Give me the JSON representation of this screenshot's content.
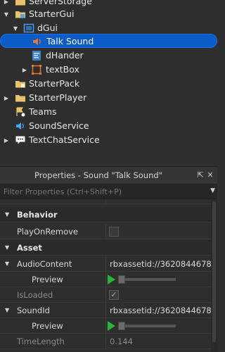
{
  "explorer": {
    "items": [
      {
        "label": "ServerStorage",
        "icon": "folder-icon"
      },
      {
        "label": "StarterGui",
        "icon": "startergui-icon"
      },
      {
        "label": "dGui",
        "icon": "screengui-icon"
      },
      {
        "label": "Talk Sound",
        "icon": "sound-icon"
      },
      {
        "label": "dHander",
        "icon": "script-icon"
      },
      {
        "label": "textBox",
        "icon": "frame-icon"
      },
      {
        "label": "StarterPack",
        "icon": "folder-icon"
      },
      {
        "label": "StarterPlayer",
        "icon": "folder-icon"
      },
      {
        "label": "Teams",
        "icon": "teams-icon"
      },
      {
        "label": "SoundService",
        "icon": "soundservice-icon"
      },
      {
        "label": "TextChatService",
        "icon": "chat-icon"
      }
    ]
  },
  "properties": {
    "title": "Properties - Sound \"Talk Sound\"",
    "filter_placeholder": "Filter Properties (Ctrl+Shift+P)",
    "sections": {
      "behavior": "Behavior",
      "asset": "Asset"
    },
    "rows": {
      "play_on_remove": "PlayOnRemove",
      "audio_content": "AudioContent",
      "audio_content_value": "rbxassetid://3620844678",
      "preview": "Preview",
      "is_loaded": "IsLoaded",
      "sound_id": "SoundId",
      "sound_id_value": "rbxassetid://3620844678",
      "preview2": "Preview",
      "time_length": "TimeLength",
      "time_length_value": "0.144"
    }
  },
  "colors": {
    "selection": "#0b5cc6",
    "play_green": "#29b53a",
    "sound_orange": "#e87a2c"
  }
}
